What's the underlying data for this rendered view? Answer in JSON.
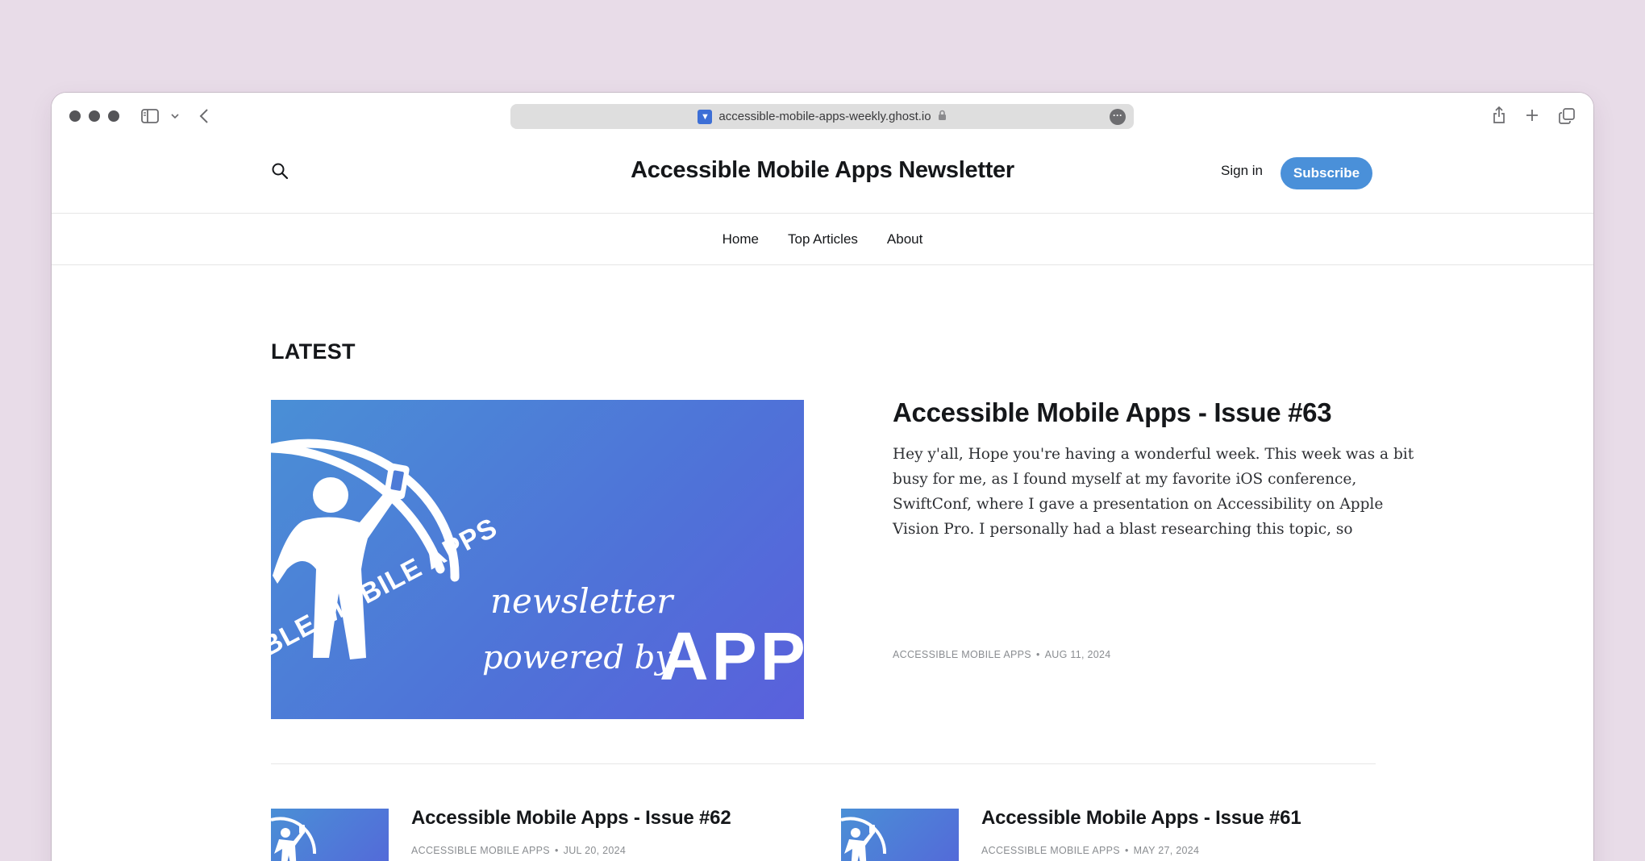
{
  "browser": {
    "url": "accessible-mobile-apps-weekly.ghost.io",
    "favicon_glyph": "▼"
  },
  "header": {
    "site_title": "Accessible Mobile Apps Newsletter",
    "signin_label": "Sign in",
    "subscribe_label": "Subscribe"
  },
  "nav": {
    "items": [
      {
        "label": "Home"
      },
      {
        "label": "Top Articles"
      },
      {
        "label": "About"
      }
    ]
  },
  "main": {
    "section_title": "LATEST",
    "feature": {
      "title": "Accessible Mobile Apps - Issue #63",
      "excerpt": "Hey y'all, Hope you're having a wonderful week. This week was a bit busy for me, as I found myself at my favorite iOS conference, SwiftConf, where I gave a presentation on Accessibility on Apple Vision Pro. I personally had a blast researching this topic, so",
      "author": "ACCESSIBLE MOBILE APPS",
      "date": "AUG 11, 2024",
      "image_text": {
        "ring": "BLE MOBILE APPS",
        "line1": "newsletter",
        "line2": "powered by",
        "brand": "APP"
      }
    },
    "posts": [
      {
        "title": "Accessible Mobile Apps - Issue #62",
        "author": "ACCESSIBLE MOBILE APPS",
        "date": "JUL 20, 2024"
      },
      {
        "title": "Accessible Mobile Apps - Issue #61",
        "author": "ACCESSIBLE MOBILE APPS",
        "date": "MAY 27, 2024"
      }
    ]
  },
  "colors": {
    "accent": "#4a90d9",
    "background": "#e8dce8",
    "image_gradient_start": "#4a8fd6",
    "image_gradient_end": "#5a5fdc"
  }
}
